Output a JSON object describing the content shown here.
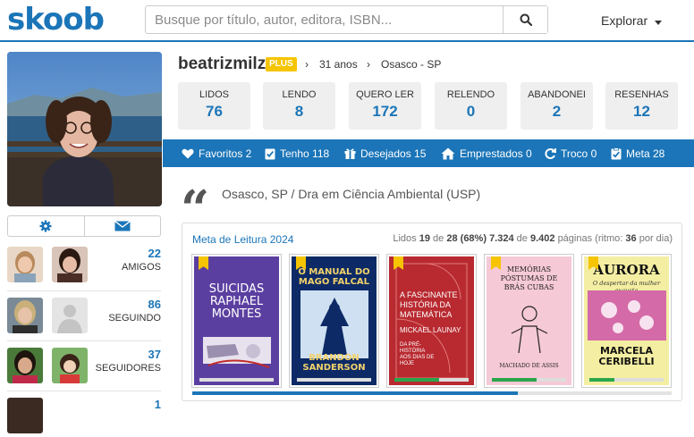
{
  "header": {
    "logo": "skoob",
    "search_placeholder": "Busque por título, autor, editora, ISBN...",
    "explore_label": "Explorar"
  },
  "profile": {
    "username": "beatrizmilz",
    "badge": "PLUS",
    "age": "31 anos",
    "location": "Osasco - SP",
    "bio": "Osasco, SP / Dra em Ciência Ambiental (USP)"
  },
  "stats": [
    {
      "label": "LIDOS",
      "value": "76"
    },
    {
      "label": "LENDO",
      "value": "8"
    },
    {
      "label": "QUERO LER",
      "value": "172"
    },
    {
      "label": "RELENDO",
      "value": "0"
    },
    {
      "label": "ABANDONEI",
      "value": "2"
    },
    {
      "label": "RESENHAS",
      "value": "12"
    }
  ],
  "bluebar": [
    {
      "label": "Favoritos 2",
      "icon": "heart-icon"
    },
    {
      "label": "Tenho 118",
      "icon": "check-icon"
    },
    {
      "label": "Desejados 15",
      "icon": "gift-icon"
    },
    {
      "label": "Emprestados 0",
      "icon": "house-icon"
    },
    {
      "label": "Troco 0",
      "icon": "refresh-icon"
    },
    {
      "label": "Meta 28",
      "icon": "clipboard-icon"
    }
  ],
  "social": [
    {
      "count": "22",
      "label": "AMIGOS"
    },
    {
      "count": "86",
      "label": "SEGUINDO"
    },
    {
      "count": "37",
      "label": "SEGUIDORES"
    },
    {
      "count": "1",
      "label": ""
    }
  ],
  "goal": {
    "title": "Meta de Leitura 2024",
    "lidos_label": "Lidos",
    "read": "19",
    "de_label": "de",
    "total": "28",
    "percent": "(68%)",
    "pages_read": "7.324",
    "pages_total": "9.402",
    "pages_label": "páginas (ritmo:",
    "rhythm": "36",
    "rhythm_suffix": "por dia)",
    "progress": 0.68
  },
  "books": [
    {
      "title_line1": "SUICIDAS",
      "title_line2": "RAPHAEL",
      "title_line3": "MONTES",
      "progress": 0.0,
      "bg": "#5b3fa0"
    },
    {
      "title_line1": "O MANUAL DO",
      "title_line2": "MAGO FALCAL",
      "title_line3": "BRANDON SANDERSON",
      "progress": 0.0,
      "bg": "#0d2a66"
    },
    {
      "title_line1": "A FASCINANTE HISTÓRIA DA MATEMÁTICA",
      "title_line2": "MICKAEL LAUNAY",
      "title_line3": "DA PRÉ-HISTÓRIA AOS DIAS DE HOJE",
      "progress": 0.55,
      "bg": "#b82a30"
    },
    {
      "title_line1": "MEMÓRIAS PÓSTUMAS DE",
      "title_line2": "BRÁS CUBAS",
      "title_line3": "MACHADO DE ASSIS",
      "progress": 0.55,
      "bg": "#f6c9d6"
    },
    {
      "title_line1": "AURORA",
      "title_line2": "O despertar da mulher exausta",
      "title_line3": "MARCELA CERIBELLI",
      "progress": 0.3,
      "bg": "#f4eea2"
    }
  ]
}
